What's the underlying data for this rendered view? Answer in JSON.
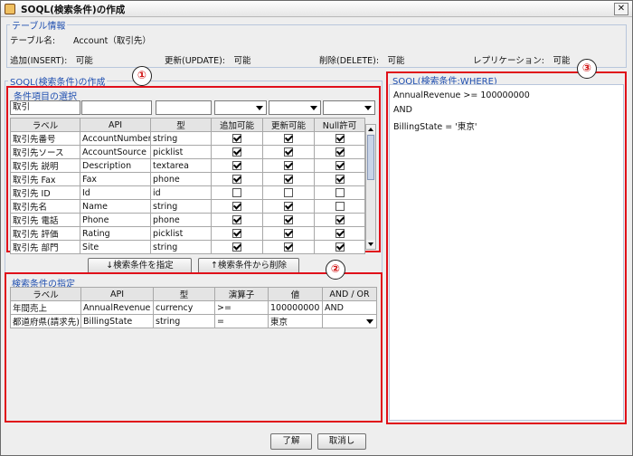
{
  "window": {
    "title": "SOQL(検索条件)の作成",
    "close_glyph": "✕"
  },
  "table_info": {
    "group_title": "テーブル情報",
    "name_label": "テーブル名:",
    "name_value": "Account（取引先）",
    "insert": "追加(INSERT):　可能",
    "update": "更新(UPDATE):　可能",
    "delete": "削除(DELETE):　可能",
    "replication": "レプリケーション:　可能"
  },
  "soql_section": {
    "group_title": "SOQL(検索条件)の作成"
  },
  "field_select": {
    "group_title": "条件項目の選択",
    "filter_text": "取引",
    "columns": [
      "ラベル",
      "API",
      "型",
      "追加可能",
      "更新可能",
      "Null許可"
    ],
    "rows": [
      {
        "label": "取引先番号",
        "api": "AccountNumber",
        "type": "string",
        "c1": true,
        "c2": true,
        "c3": true
      },
      {
        "label": "取引先ソース",
        "api": "AccountSource",
        "type": "picklist",
        "c1": true,
        "c2": true,
        "c3": true
      },
      {
        "label": "取引先 説明",
        "api": "Description",
        "type": "textarea",
        "c1": true,
        "c2": true,
        "c3": true
      },
      {
        "label": "取引先 Fax",
        "api": "Fax",
        "type": "phone",
        "c1": true,
        "c2": true,
        "c3": true
      },
      {
        "label": "取引先 ID",
        "api": "Id",
        "type": "id",
        "c1": false,
        "c2": false,
        "c3": false
      },
      {
        "label": "取引先名",
        "api": "Name",
        "type": "string",
        "c1": true,
        "c2": true,
        "c3": false
      },
      {
        "label": "取引先 電話",
        "api": "Phone",
        "type": "phone",
        "c1": true,
        "c2": true,
        "c3": true
      },
      {
        "label": "取引先 評価",
        "api": "Rating",
        "type": "picklist",
        "c1": true,
        "c2": true,
        "c3": true
      },
      {
        "label": "取引先 部門",
        "api": "Site",
        "type": "string",
        "c1": true,
        "c2": true,
        "c3": true
      }
    ]
  },
  "buttons": {
    "add_condition": "↓検索条件を指定",
    "remove_condition": "↑検索条件から削除",
    "ok": "了解",
    "cancel": "取消し"
  },
  "conditions": {
    "group_title": "検索条件の指定",
    "columns": [
      "ラベル",
      "API",
      "型",
      "演算子",
      "値",
      "AND / OR"
    ],
    "rows": [
      {
        "label": "年間売上",
        "api": "AnnualRevenue",
        "type": "currency",
        "op": ">=",
        "value": "100000000",
        "andor": "AND",
        "dropdown": false
      },
      {
        "label": "都道府県(請求先)",
        "api": "BillingState",
        "type": "string",
        "op": "=",
        "value": "東京",
        "andor": "",
        "dropdown": true
      }
    ]
  },
  "where": {
    "group_title": "SOQL(検索条件:WHERE)",
    "lines": [
      "AnnualRevenue >= 100000000",
      "AND",
      "BillingState = '東京'"
    ]
  },
  "annotations": {
    "n1": "①",
    "n2": "②",
    "n3": "③"
  },
  "colors": {
    "accent_title": "#1f4fb0",
    "highlight_red": "#e0101a"
  }
}
